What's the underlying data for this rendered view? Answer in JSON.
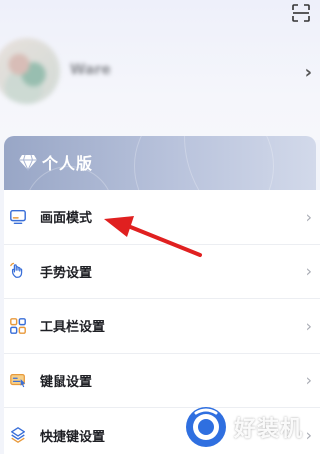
{
  "profile": {
    "username": "Ware"
  },
  "banner": {
    "label": "个人版"
  },
  "menu": {
    "items": [
      {
        "label": "画面模式",
        "icon": "monitor-icon"
      },
      {
        "label": "手势设置",
        "icon": "gesture-icon"
      },
      {
        "label": "工具栏设置",
        "icon": "toolbar-grid-icon"
      },
      {
        "label": "键鼠设置",
        "icon": "keyboard-mouse-icon"
      },
      {
        "label": "快捷键设置",
        "icon": "shortcut-layers-icon"
      }
    ],
    "chevron": "›"
  },
  "watermark": {
    "text": "好装机"
  },
  "colors": {
    "accent_blue": "#3a6fd8",
    "icon_orange": "#e89a3c",
    "arrow_red": "#e02020",
    "banner_start": "#98a6c6",
    "banner_end": "#d2d9ea"
  }
}
